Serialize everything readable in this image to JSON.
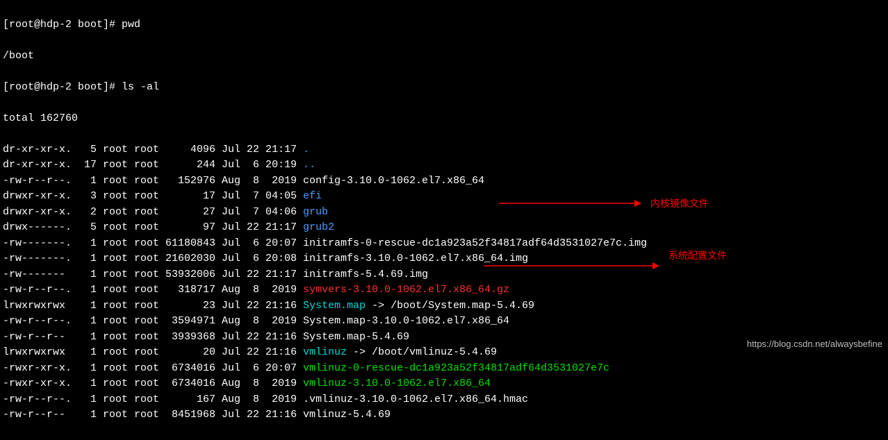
{
  "prompt1": "[root@hdp-2 boot]# ",
  "cmd1": "pwd",
  "out_pwd": "/boot",
  "prompt2": "[root@hdp-2 boot]# ",
  "cmd2": "ls -al",
  "total_line": "total 162760",
  "rows": [
    {
      "perm": "dr-xr-xr-x.",
      "li": "  5",
      "own": "root root",
      "size": "    4096",
      "date": "Jul 22 21:17",
      "name": ".",
      "cls": "blue"
    },
    {
      "perm": "dr-xr-xr-x.",
      "li": " 17",
      "own": "root root",
      "size": "     244",
      "date": "Jul  6 20:19",
      "name": "..",
      "cls": "blue"
    },
    {
      "perm": "-rw-r--r--.",
      "li": "  1",
      "own": "root root",
      "size": "  152976",
      "date": "Aug  8  2019",
      "name": "config-3.10.0-1062.el7.x86_64",
      "cls": "white"
    },
    {
      "perm": "drwxr-xr-x.",
      "li": "  3",
      "own": "root root",
      "size": "      17",
      "date": "Jul  7 04:05",
      "name": "efi",
      "cls": "blue"
    },
    {
      "perm": "drwxr-xr-x.",
      "li": "  2",
      "own": "root root",
      "size": "      27",
      "date": "Jul  7 04:06",
      "name": "grub",
      "cls": "blue"
    },
    {
      "perm": "drwx------.",
      "li": "  5",
      "own": "root root",
      "size": "      97",
      "date": "Jul 22 21:17",
      "name": "grub2",
      "cls": "blue"
    },
    {
      "perm": "-rw-------.",
      "li": "  1",
      "own": "root root",
      "size": "61180843",
      "date": "Jul  6 20:07",
      "name": "initramfs-0-rescue-dc1a923a52f34817adf64d3531027e7c.img",
      "cls": "white"
    },
    {
      "perm": "-rw-------.",
      "li": "  1",
      "own": "root root",
      "size": "21602030",
      "date": "Jul  6 20:08",
      "name": "initramfs-3.10.0-1062.el7.x86_64.img",
      "cls": "white"
    },
    {
      "perm": "-rw-------",
      "li": "   1",
      "own": "root root",
      "size": "53932006",
      "date": "Jul 22 21:17",
      "name": "initramfs-5.4.69.img",
      "cls": "white"
    },
    {
      "perm": "-rw-r--r--.",
      "li": "  1",
      "own": "root root",
      "size": "  318717",
      "date": "Aug  8  2019",
      "name": "symvers-3.10.0-1062.el7.x86_64.gz",
      "cls": "red"
    },
    {
      "perm": "lrwxrwxrwx",
      "li": "   1",
      "own": "root root",
      "size": "      23",
      "date": "Jul 22 21:16",
      "name": "System.map",
      "cls": "cyan",
      "arrow": " -> /boot/System.map-5.4.69"
    },
    {
      "perm": "-rw-r--r--.",
      "li": "  1",
      "own": "root root",
      "size": " 3594971",
      "date": "Aug  8  2019",
      "name": "System.map-3.10.0-1062.el7.x86_64",
      "cls": "white"
    },
    {
      "perm": "-rw-r--r--",
      "li": "   1",
      "own": "root root",
      "size": " 3939368",
      "date": "Jul 22 21:16",
      "name": "System.map-5.4.69",
      "cls": "white"
    },
    {
      "perm": "lrwxrwxrwx",
      "li": "   1",
      "own": "root root",
      "size": "      20",
      "date": "Jul 22 21:16",
      "name": "vmlinuz",
      "cls": "cyan",
      "arrow": " -> /boot/vmlinuz-5.4.69"
    },
    {
      "perm": "-rwxr-xr-x.",
      "li": "  1",
      "own": "root root",
      "size": " 6734016",
      "date": "Jul  6 20:07",
      "name": "vmlinuz-0-rescue-dc1a923a52f34817adf64d3531027e7c",
      "cls": "green"
    },
    {
      "perm": "-rwxr-xr-x.",
      "li": "  1",
      "own": "root root",
      "size": " 6734016",
      "date": "Aug  8  2019",
      "name": "vmlinuz-3.10.0-1062.el7.x86_64",
      "cls": "green"
    },
    {
      "perm": "-rw-r--r--.",
      "li": "  1",
      "own": "root root",
      "size": "     167",
      "date": "Aug  8  2019",
      "name": ".vmlinuz-3.10.0-1062.el7.x86_64.hmac",
      "cls": "white"
    },
    {
      "perm": "-rw-r--r--",
      "li": "   1",
      "own": "root root",
      "size": " 8451968",
      "date": "Jul 22 21:16",
      "name": "vmlinuz-5.4.69",
      "cls": "white"
    }
  ],
  "annot1": "内核镜像文件",
  "annot2": "系统配置文件",
  "watermark": "https://blog.csdn.net/alwaysbefine"
}
